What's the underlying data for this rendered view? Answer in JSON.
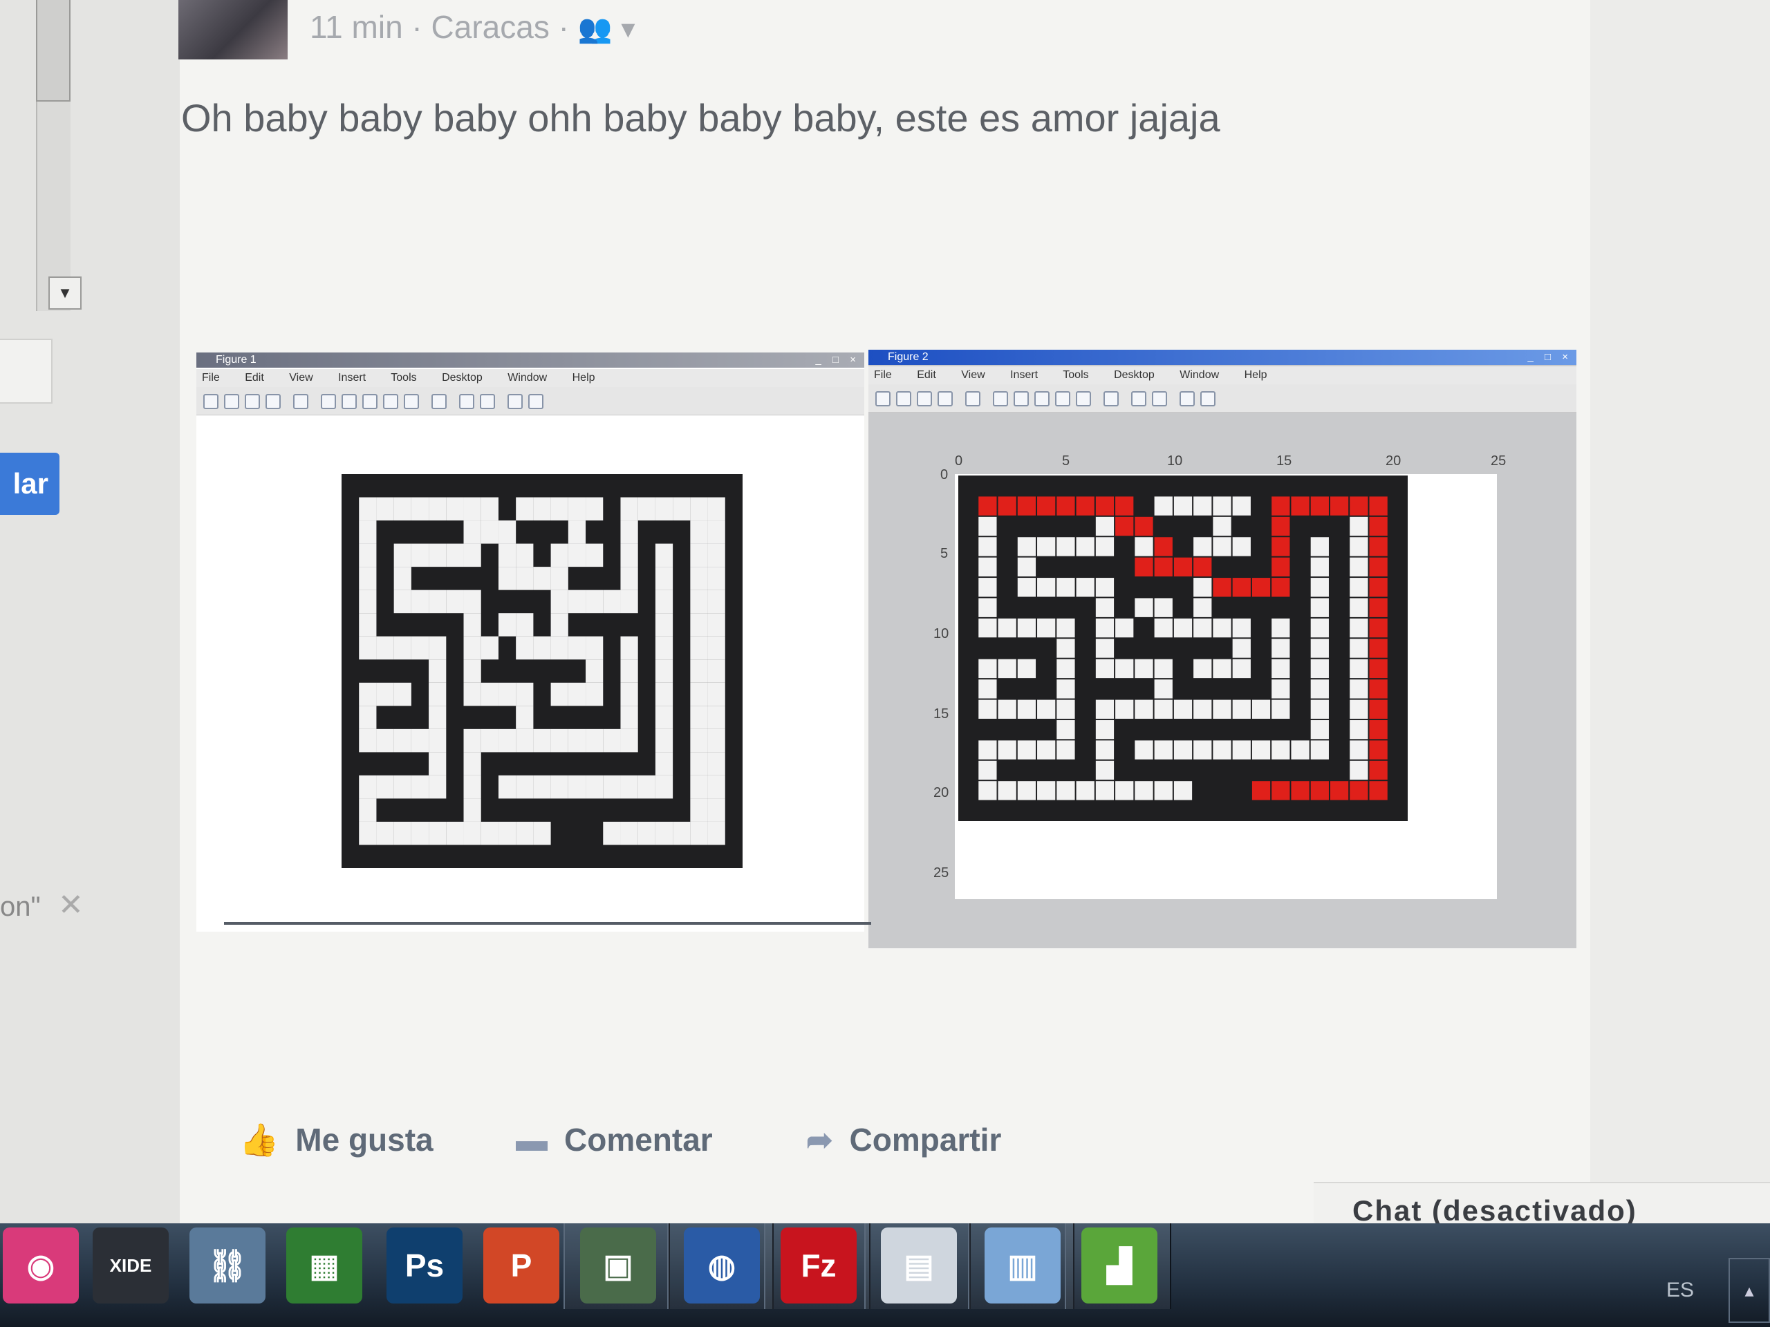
{
  "left_column": {
    "scroll_down_glyph": "▼",
    "button_label": "lar",
    "snippet_text": "on\"",
    "close_glyph": "✕"
  },
  "post": {
    "meta": {
      "time": "11 min",
      "separator": " · ",
      "location": "Caracas",
      "audience_icon": "friends-icon",
      "dropdown_glyph": "▾"
    },
    "text": "Oh baby baby baby ohh baby baby baby, este es amor jajaja",
    "actions": {
      "like": "Me gusta",
      "comment": "Comentar",
      "share": "Compartir"
    }
  },
  "figure1": {
    "title": "Figure 1",
    "menu": [
      "File",
      "Edit",
      "View",
      "Insert",
      "Tools",
      "Desktop",
      "Window",
      "Help"
    ],
    "window_buttons": "_ □ ×"
  },
  "figure2": {
    "title": "Figure 2",
    "menu": [
      "File",
      "Edit",
      "View",
      "Insert",
      "Tools",
      "Desktop",
      "Window",
      "Help"
    ],
    "window_buttons": "_ □ ×",
    "x_ticks": [
      "0",
      "5",
      "10",
      "15",
      "20",
      "25"
    ],
    "y_ticks": [
      "0",
      "5",
      "10",
      "15",
      "20",
      "25"
    ]
  },
  "maze": {
    "wall_color": "#1f1f21",
    "path_color": "#f2f2f2",
    "solution_color": "#e0201a",
    "grid": [
      "00000000000000000000000",
      "0RRRRRRRR0111110RRRRRR0",
      "01000001RR000100R0001R0",
      "0101111101R01110R0101R0",
      "010100000RRRR000R0101R0",
      "0101111100001RRRR0101R0",
      "010000010110100000101R0",
      "011111011011111010101R0",
      "000001010000001010101R0",
      "011101011110111010101R0",
      "010001000010000010101R0",
      "011111011111111110101R0",
      "000001010000000000101R0",
      "011111010111111111101R0",
      "010000010000000000001R0",
      "011111111111000RRRRRRR0",
      "00000000000000000000000"
    ]
  },
  "chat": {
    "label": "Chat (desactivado)"
  },
  "taskbar": {
    "apps": [
      {
        "name": "messenger",
        "glyph": "◉",
        "color": "#d93a7a"
      },
      {
        "name": "xide",
        "glyph": "XIDE",
        "color": "#2b2f36"
      },
      {
        "name": "network-tool",
        "glyph": "⛓",
        "color": "#5a7a9a"
      },
      {
        "name": "office",
        "glyph": "▦",
        "color": "#2f7d32"
      },
      {
        "name": "photoshop",
        "glyph": "Ps",
        "color": "#0f3f6e"
      },
      {
        "name": "powerpoint",
        "glyph": "P",
        "color": "#d24726"
      },
      {
        "name": "screen-capture",
        "glyph": "▣",
        "color": "#4a6b4a"
      },
      {
        "name": "browser",
        "glyph": "◍",
        "color": "#2a5ba6"
      },
      {
        "name": "filezilla",
        "glyph": "Fz",
        "color": "#c8141e"
      },
      {
        "name": "file-manager",
        "glyph": "▤",
        "color": "#cfd6de"
      },
      {
        "name": "calculator",
        "glyph": "▥",
        "color": "#7aa6d6"
      },
      {
        "name": "matlab-plot",
        "glyph": "▟",
        "color": "#5aa63a"
      }
    ],
    "language": "ES",
    "tray_arrow": "▴"
  }
}
